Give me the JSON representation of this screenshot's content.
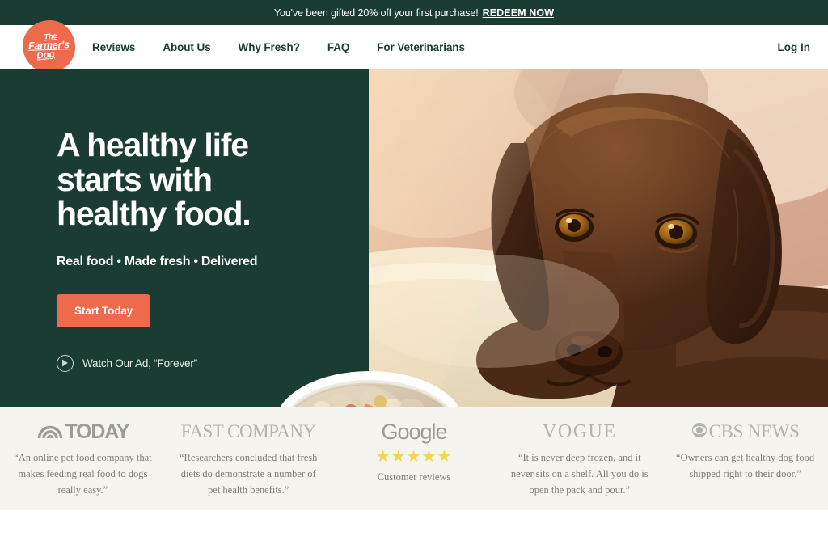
{
  "colors": {
    "brand_green": "#1b3c32",
    "brand_orange": "#ee6a4d",
    "press_bg": "#f5f4ef",
    "star_yellow": "#f7d44c",
    "logo_gray": "#9b9b98"
  },
  "promo": {
    "message": "You've been gifted 20% off your first purchase!",
    "link_label": "REDEEM NOW"
  },
  "header": {
    "logo": {
      "line1": "The",
      "line2": "Farmer's",
      "line3": "Dog"
    },
    "nav": [
      {
        "label": "Reviews"
      },
      {
        "label": "About Us"
      },
      {
        "label": "Why Fresh?"
      },
      {
        "label": "FAQ"
      },
      {
        "label": "For Veterinarians"
      }
    ],
    "login_label": "Log In"
  },
  "hero": {
    "headline_line1": "A healthy life",
    "headline_line2": "starts with",
    "headline_line3": "healthy food.",
    "subhead": "Real food • Made fresh • Delivered",
    "cta_label": "Start Today",
    "watch_label": "Watch Our Ad, “Forever”",
    "image_alt": "Chocolate Labrador puppy lying on a cream blanket beside a white bowl of fresh dog food"
  },
  "press": {
    "items": [
      {
        "brand": "TODAY",
        "logo_kind": "today-rainbow",
        "quote": "“An online pet food company that makes feeding real food to dogs really easy.”"
      },
      {
        "brand": "FAST COMPANY",
        "logo_kind": "fast-company-wordmark",
        "quote": "“Researchers concluded that fresh diets do demonstrate a number of pet health benefits.”"
      },
      {
        "brand": "Google",
        "logo_kind": "google-wordmark",
        "stars": "★★★★★",
        "rating": 5,
        "caption": "Customer reviews"
      },
      {
        "brand": "VOGUE",
        "logo_kind": "vogue-wordmark",
        "quote": "“It is never deep frozen, and it never sits on a shelf. All you do is open the pack and pour.”"
      },
      {
        "brand": "CBS NEWS",
        "logo_kind": "cbs-eye-wordmark",
        "quote": "“Owners can get healthy dog food shipped right to their door.”"
      }
    ]
  }
}
